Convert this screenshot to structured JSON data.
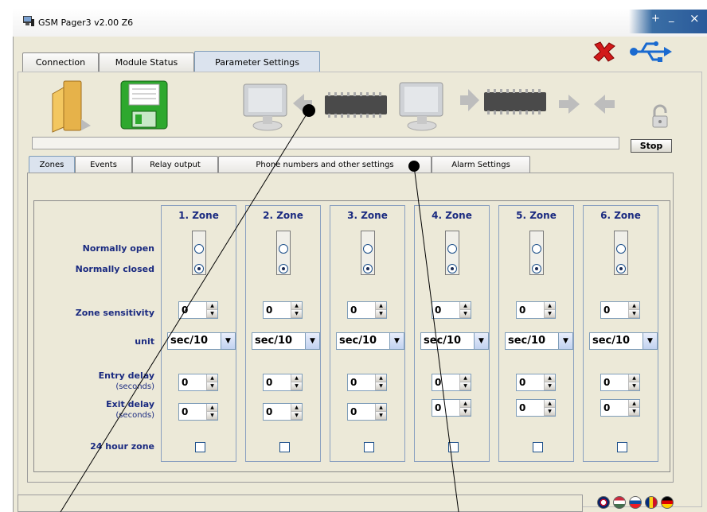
{
  "window": {
    "title": "GSM Pager3  v2.00 Z6",
    "controls": [
      "+",
      "_",
      "×"
    ]
  },
  "main_tabs": [
    {
      "label": "Connection",
      "active": false
    },
    {
      "label": "Module Status",
      "active": false
    },
    {
      "label": "Parameter Settings",
      "active": true
    }
  ],
  "toolbar": {
    "stop_label": "Stop",
    "icons": [
      "folder-open-icon",
      "save-disk-icon",
      "pc-read-from-module-icon",
      "pc-write-to-module-icon",
      "transfer-arrows-icon",
      "lock-icon",
      "close-x-icon",
      "usb-icon"
    ]
  },
  "sub_tabs": [
    {
      "label": "Zones",
      "active": true
    },
    {
      "label": "Events",
      "active": false
    },
    {
      "label": "Relay output",
      "active": false
    },
    {
      "label": "Phone numbers and other settings",
      "active": false
    },
    {
      "label": "Alarm Settings",
      "active": false
    }
  ],
  "row_labels": {
    "normally_open": "Normally open",
    "normally_closed": "Normally closed",
    "zone_sensitivity": "Zone sensitivity",
    "unit": "unit",
    "entry_delay": "Entry delay",
    "entry_delay_unit": "(seconds)",
    "exit_delay": "Exit delay",
    "exit_delay_unit": "(seconds)",
    "hour24_zone": "24 hour zone"
  },
  "zones": [
    {
      "name": "1. Zone",
      "mode": "Normally closed",
      "sensitivity": "0",
      "unit": "sec/10",
      "entry_delay": "0",
      "exit_delay": "0",
      "hour24": false
    },
    {
      "name": "2. Zone",
      "mode": "Normally closed",
      "sensitivity": "0",
      "unit": "sec/10",
      "entry_delay": "0",
      "exit_delay": "0",
      "hour24": false
    },
    {
      "name": "3. Zone",
      "mode": "Normally closed",
      "sensitivity": "0",
      "unit": "sec/10",
      "entry_delay": "0",
      "exit_delay": "0",
      "hour24": false
    },
    {
      "name": "4. Zone",
      "mode": "Normally closed",
      "sensitivity": "0",
      "unit": "sec/10",
      "entry_delay": "0",
      "exit_delay": "0",
      "hour24": false
    },
    {
      "name": "5. Zone",
      "mode": "Normally closed",
      "sensitivity": "0",
      "unit": "sec/10",
      "entry_delay": "0",
      "exit_delay": "0",
      "hour24": false
    },
    {
      "name": "6. Zone",
      "mode": "Normally closed",
      "sensitivity": "0",
      "unit": "sec/10",
      "entry_delay": "0",
      "exit_delay": "0",
      "hour24": false
    }
  ],
  "language_flags": [
    "uk-flag-icon",
    "hungary-flag-icon",
    "slovakia-flag-icon",
    "romania-flag-icon",
    "germany-flag-icon"
  ],
  "colors": {
    "label_blue": "#1a2a80",
    "tab_active": "#dbe3ee",
    "window_bg": "#ece9d8"
  }
}
